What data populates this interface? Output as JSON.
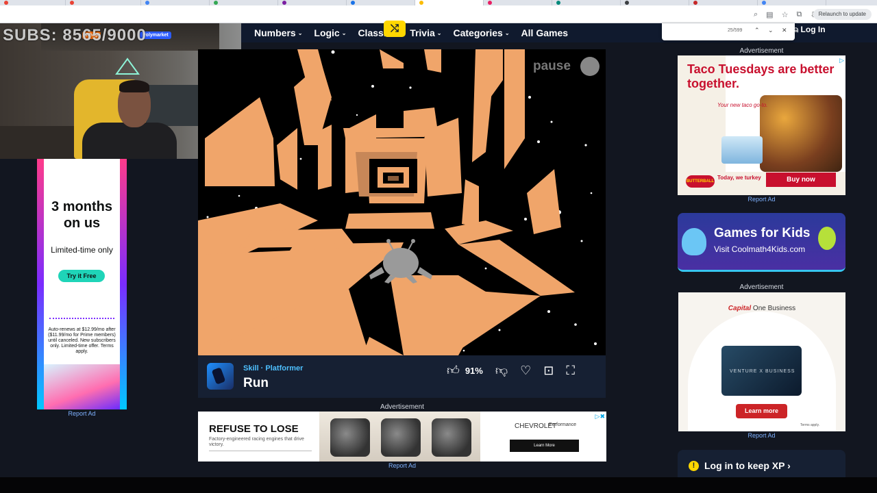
{
  "browser": {
    "relaunch_label": "Relaunch to update",
    "tab_colors": [
      "#ea4335",
      "#4285f4",
      "#34a853",
      "#7b1fa2",
      "#fbbc05",
      "#e91e63",
      "#00897b",
      "#1a73e8",
      "#3c4043",
      "#c62828"
    ]
  },
  "stream_overlay": {
    "subs_goal": "SUBS: 8565/9000",
    "sponsor_1": "Whop",
    "sponsor_2": "Polymarket"
  },
  "site_nav": {
    "items": [
      {
        "label": "Numbers",
        "chev": "⌄"
      },
      {
        "label": "Logic",
        "chev": "⌄"
      },
      {
        "label": "Classic",
        "chev": "⌄"
      },
      {
        "label": "Trivia",
        "chev": "⌄"
      },
      {
        "label": "Categories",
        "chev": "⌄"
      }
    ],
    "all_games": "All Games",
    "random_icon": "shuffle-icon",
    "login": "Log In"
  },
  "find_bar": {
    "count": "25/599",
    "prev": "⌃",
    "next": "⌄",
    "close": "✕"
  },
  "game": {
    "pause_label": "pause",
    "tags": "Skill · Platformer",
    "title": "Run",
    "like_pct": "91%",
    "colors": {
      "tunnel": "#f0a56a",
      "space": "#000000",
      "alien": "#999999"
    }
  },
  "ads": {
    "label": "Advertisement",
    "report": "Report Ad",
    "left": {
      "headline": "3 months on us",
      "subhead": "Limited-time only",
      "cta": "Try it Free",
      "fine_print": "Auto-renews at $12.99/mo after ($11.99/mo for Prime members) until canceled. New subscribers only. Limited-time offer. Terms apply."
    },
    "banner": {
      "headline": "REFUSE TO LOSE",
      "sub": "Factory-engineered racing engines that drive victory.",
      "chevy": "CHEVROLET",
      "perf": "Performance",
      "cta": "Learn More"
    },
    "taco": {
      "headline": "Taco Tuesdays are better together.",
      "sub": "Your new taco go-to.",
      "brand": "BUTTERBALL",
      "tagline": "Today, we turkey",
      "cta": "Buy now"
    },
    "coolmath": {
      "headline": "Games for Kids",
      "sub": "Visit Coolmath4Kids.com"
    },
    "capitalone": {
      "brand": "Capital",
      "brand2": "One Business",
      "card": "VENTURE X BUSINESS",
      "cta": "Learn more",
      "terms": "Terms apply."
    }
  },
  "xp_prompt": {
    "text": "Log in to keep XP",
    "arrow": "›"
  }
}
